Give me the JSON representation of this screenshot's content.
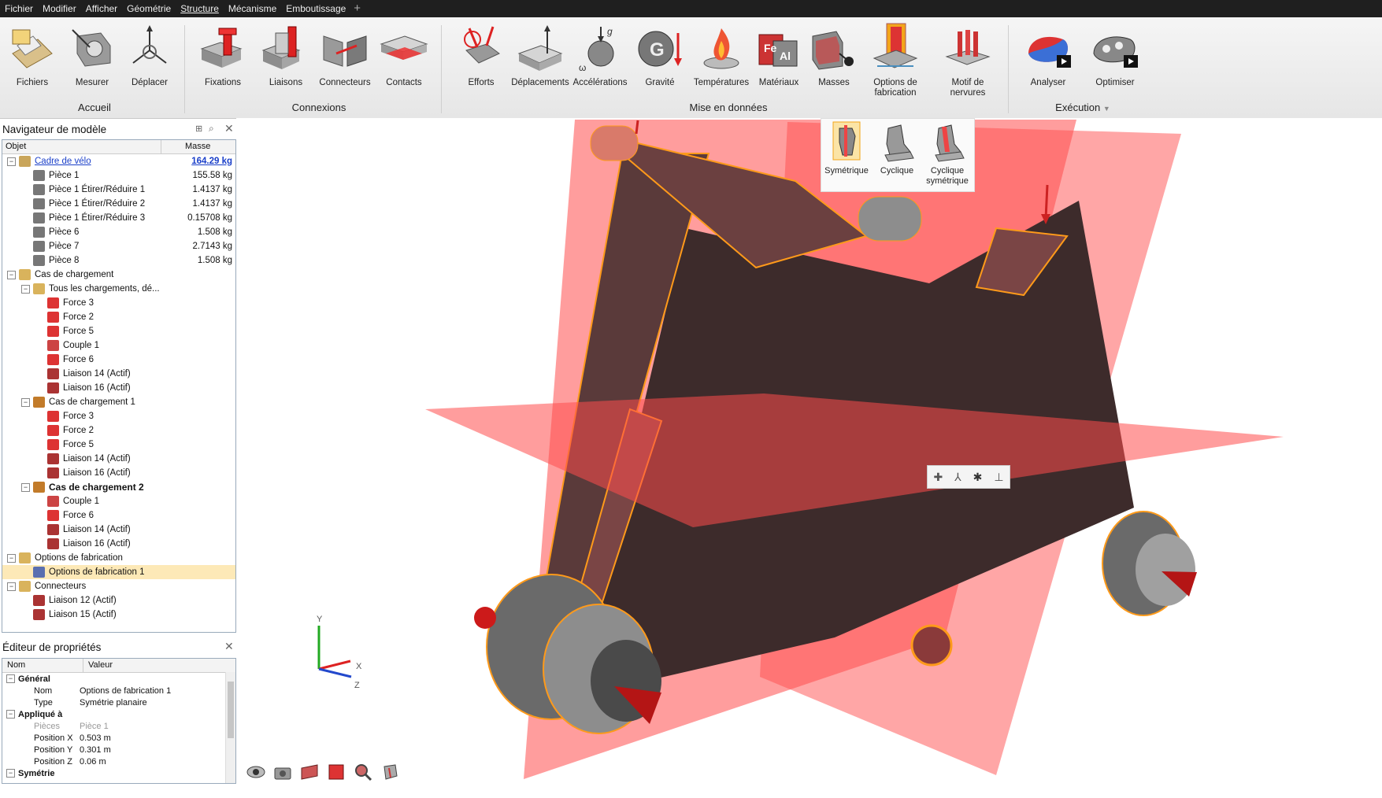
{
  "menu": [
    "Fichier",
    "Modifier",
    "Afficher",
    "Géométrie",
    "Structure",
    "Mécanisme",
    "Emboutissage"
  ],
  "menu_active": "Structure",
  "ribbon": {
    "groups": [
      "Accueil",
      "Connexions",
      "Mise en données",
      "Exécution"
    ],
    "buttons": {
      "fichiers": "Fichiers",
      "mesurer": "Mesurer",
      "deplacer": "Déplacer",
      "fixations": "Fixations",
      "liaisons": "Liaisons",
      "connecteurs": "Connecteurs",
      "contacts": "Contacts",
      "efforts": "Efforts",
      "deplacements": "Déplacements",
      "accelerations": "Accélérations",
      "gravite": "Gravité",
      "temperatures": "Températures",
      "materiaux": "Matériaux",
      "masses": "Masses",
      "options_fab_1": "Options de",
      "options_fab_2": "fabrication",
      "motif": "Motif de nervures",
      "analyser": "Analyser",
      "optimiser": "Optimiser"
    },
    "dropdown_arrow": "▼"
  },
  "popup": {
    "symetrique": "Symétrique",
    "cyclique": "Cyclique",
    "cyclique_sym_1": "Cyclique",
    "cyclique_sym_2": "symétrique"
  },
  "navigator": {
    "title": "Navigateur de modèle",
    "col_object": "Objet",
    "col_mass": "Masse",
    "rows": [
      {
        "label": "Cadre de vélo",
        "mass": "164.29 kg",
        "icon": "assembly-icon",
        "toggle": "−"
      },
      {
        "label": "Pièce 1",
        "mass": "155.58 kg",
        "icon": "part-icon"
      },
      {
        "label": "Pièce 1 Étirer/Réduire 1",
        "mass": "1.4137 kg",
        "icon": "part-icon"
      },
      {
        "label": "Pièce 1 Étirer/Réduire 2",
        "mass": "1.4137 kg",
        "icon": "part-icon"
      },
      {
        "label": "Pièce 1 Étirer/Réduire 3",
        "mass": "0.15708 kg",
        "icon": "part-icon"
      },
      {
        "label": "Pièce 6",
        "mass": "1.508 kg",
        "icon": "part-icon"
      },
      {
        "label": "Pièce 7",
        "mass": "2.7143 kg",
        "icon": "part-icon"
      },
      {
        "label": "Pièce 8",
        "mass": "1.508 kg",
        "icon": "part-icon"
      },
      {
        "label": "Cas de chargement",
        "mass": "",
        "icon": "folder-icon",
        "toggle": "−"
      },
      {
        "label": "Tous les chargements, dé...",
        "mass": "",
        "icon": "folder-icon",
        "toggle": "−"
      },
      {
        "label": "Force 3",
        "mass": "",
        "icon": "force-icon"
      },
      {
        "label": "Force 2",
        "mass": "",
        "icon": "force-icon"
      },
      {
        "label": "Force 5",
        "mass": "",
        "icon": "force-icon"
      },
      {
        "label": "Couple 1",
        "mass": "",
        "icon": "torque-icon"
      },
      {
        "label": "Force 6",
        "mass": "",
        "icon": "force-icon"
      },
      {
        "label": "Liaison 14 (Actif)",
        "mass": "",
        "icon": "joint-icon"
      },
      {
        "label": "Liaison 16 (Actif)",
        "mass": "",
        "icon": "joint-icon"
      },
      {
        "label": "Cas de chargement 1",
        "mass": "",
        "icon": "loadcase-icon",
        "toggle": "−"
      },
      {
        "label": "Force 3",
        "mass": "",
        "icon": "force-icon"
      },
      {
        "label": "Force 2",
        "mass": "",
        "icon": "force-icon"
      },
      {
        "label": "Force 5",
        "mass": "",
        "icon": "force-icon"
      },
      {
        "label": "Liaison 14 (Actif)",
        "mass": "",
        "icon": "joint-icon"
      },
      {
        "label": "Liaison 16 (Actif)",
        "mass": "",
        "icon": "joint-icon"
      },
      {
        "label": "Cas de chargement 2",
        "mass": "",
        "icon": "loadcase-icon",
        "toggle": "−"
      },
      {
        "label": "Couple 1",
        "mass": "",
        "icon": "torque-icon"
      },
      {
        "label": "Force 6",
        "mass": "",
        "icon": "force-icon"
      },
      {
        "label": "Liaison 14 (Actif)",
        "mass": "",
        "icon": "joint-icon"
      },
      {
        "label": "Liaison 16 (Actif)",
        "mass": "",
        "icon": "joint-icon"
      },
      {
        "label": "Options de fabrication",
        "mass": "",
        "icon": "folder-icon",
        "toggle": "−"
      },
      {
        "label": "Options de fabrication 1",
        "mass": "",
        "icon": "manufacturing-icon"
      },
      {
        "label": "Connecteurs",
        "mass": "",
        "icon": "folder-icon",
        "toggle": "−"
      },
      {
        "label": "Liaison 12 (Actif)",
        "mass": "",
        "icon": "joint-icon"
      },
      {
        "label": "Liaison 15 (Actif)",
        "mass": "",
        "icon": "joint-icon"
      }
    ]
  },
  "properties": {
    "title": "Éditeur de propriétés",
    "col_name": "Nom",
    "col_value": "Valeur",
    "rows": [
      {
        "name": "Général",
        "value": "",
        "group": true
      },
      {
        "name": "Nom",
        "value": "Options de fabrication 1"
      },
      {
        "name": "Type",
        "value": "Symétrie planaire"
      },
      {
        "name": "Appliqué à",
        "value": "",
        "group": true
      },
      {
        "name": "Pièces",
        "value": "Pièce 1",
        "muted": true
      },
      {
        "name": "Position X",
        "value": "0.503 m"
      },
      {
        "name": "Position Y",
        "value": "0.301 m"
      },
      {
        "name": "Position Z",
        "value": "0.06 m"
      },
      {
        "name": "Symétrie",
        "value": "",
        "group": true
      }
    ]
  },
  "axes": {
    "x": "X",
    "y": "Y",
    "z": "Z"
  },
  "colors": {
    "plane": "#ff4d4d",
    "frame": "#3d2b2b",
    "outline": "#ff9a1a",
    "menubar": "#1f1f1f"
  }
}
